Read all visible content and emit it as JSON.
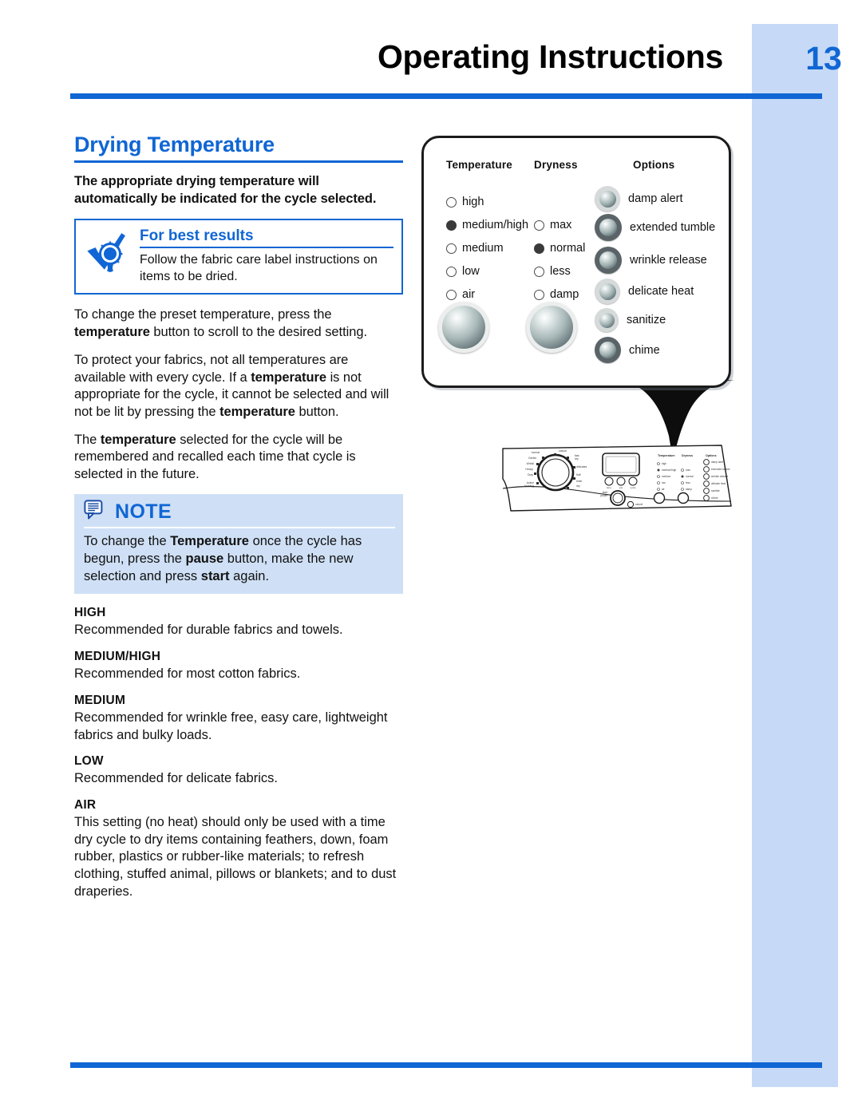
{
  "header": {
    "title": "Operating Instructions",
    "page_number": "13",
    "rule_color": "#1066d4",
    "band_color": "#c6daf7"
  },
  "section": {
    "title": "Drying Temperature",
    "lead": "The appropriate drying temperature will automatically be indicated for the cycle selected."
  },
  "best_results": {
    "icon": "award-check-icon",
    "title": "For best results",
    "text": "Follow the fabric care label instructions on items to be dried."
  },
  "paragraphs": [
    {
      "id": "p1",
      "runs": [
        {
          "t": "To change the preset temperature, press the ",
          "b": false
        },
        {
          "t": "temperature",
          "b": true
        },
        {
          "t": " button to scroll to the desired setting.",
          "b": false
        }
      ]
    },
    {
      "id": "p2",
      "runs": [
        {
          "t": "To protect your fabrics, not all temperatures are available with every cycle. If a ",
          "b": false
        },
        {
          "t": "temperature",
          "b": true
        },
        {
          "t": " is not appropriate for the cycle, it cannot be selected and will not be lit by pressing the ",
          "b": false
        },
        {
          "t": "temperature",
          "b": true
        },
        {
          "t": " button.",
          "b": false
        }
      ]
    },
    {
      "id": "p3",
      "runs": [
        {
          "t": "The ",
          "b": false
        },
        {
          "t": "temperature",
          "b": true
        },
        {
          "t": " selected for the cycle will be remembered and recalled each time that cycle is selected in the future.",
          "b": false
        }
      ]
    }
  ],
  "note": {
    "icon": "speech-bubble-note-icon",
    "title": "NOTE",
    "runs": [
      {
        "t": "To change the ",
        "b": false
      },
      {
        "t": "Temperature",
        "b": true
      },
      {
        "t": " once the cycle has begun, press the ",
        "b": false
      },
      {
        "t": "pause",
        "b": true
      },
      {
        "t": " button, make the new selection and press ",
        "b": false
      },
      {
        "t": "start",
        "b": true
      },
      {
        "t": " again.",
        "b": false
      }
    ],
    "background": "#cfe0f6"
  },
  "definitions": [
    {
      "term": "HIGH",
      "desc": "Recommended for durable fabrics and towels."
    },
    {
      "term": "MEDIUM/HIGH",
      "desc": "Recommended for most cotton fabrics."
    },
    {
      "term": "MEDIUM",
      "desc": "Recommended for wrinkle free, easy care, lightweight fabrics and bulky loads."
    },
    {
      "term": "LOW",
      "desc": "Recommended for delicate fabrics."
    },
    {
      "term": "AIR",
      "desc": "This setting (no heat) should only be used with a time dry cycle to dry items containing feathers, down, foam rubber, plastics or rubber-like materials; to refresh clothing, stuffed animal, pillows or blankets; and to dust draperies."
    }
  ],
  "callout": {
    "columns": {
      "temperature": "Temperature",
      "dryness": "Dryness",
      "options": "Options"
    },
    "temperature_leds": [
      {
        "label": "high",
        "selected": false
      },
      {
        "label": "medium/high",
        "selected": true
      },
      {
        "label": "medium",
        "selected": false
      },
      {
        "label": "low",
        "selected": false
      },
      {
        "label": "air",
        "selected": false
      }
    ],
    "dryness_leds": [
      {
        "label": "max",
        "selected": false
      },
      {
        "label": "normal",
        "selected": true
      },
      {
        "label": "less",
        "selected": false
      },
      {
        "label": "damp",
        "selected": false
      }
    ],
    "options_buttons": [
      {
        "label": "damp alert"
      },
      {
        "label": "extended tumble"
      },
      {
        "label": "wrinkle release"
      },
      {
        "label": "delicate heat"
      },
      {
        "label": "sanitize"
      },
      {
        "label": "chime"
      }
    ],
    "temperature_button": "temperature-push-button",
    "dryness_button": "dryness-push-button"
  },
  "console_drawing": {
    "name": "dryer-control-panel-illustration"
  }
}
